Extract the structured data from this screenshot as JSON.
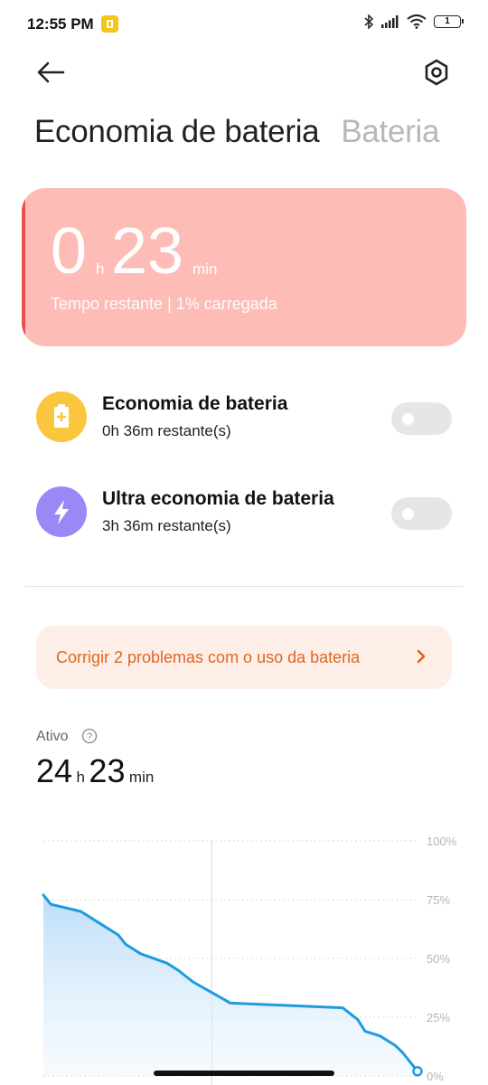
{
  "status_bar": {
    "time": "12:55 PM",
    "battery_level": "1",
    "notification_icon": "yellow-lock-app-icon"
  },
  "header": {
    "back_icon": "arrow-left-icon",
    "settings_icon": "gear-hexagon-icon"
  },
  "tabs": [
    {
      "label": "Economia de bateria",
      "active": true
    },
    {
      "label": "Bateria",
      "active": false
    }
  ],
  "summary_card": {
    "hours": "0",
    "hours_unit": "h",
    "minutes": "23",
    "minutes_unit": "min",
    "subtitle": "Tempo restante | 1% carregada",
    "bg_color": "#fdbcb5",
    "accent_color": "#e9514a"
  },
  "modes": [
    {
      "title": "Economia de bateria",
      "subtitle": "0h 36m restante(s)",
      "icon": "battery-plus-icon",
      "icon_color": "#fcc53e",
      "enabled": false
    },
    {
      "title": "Ultra economia de bateria",
      "subtitle": "3h 36m restante(s)",
      "icon": "lightning-bolt-icon",
      "icon_color": "#9b87f5",
      "enabled": false
    }
  ],
  "fix_banner": {
    "text": "Corrigir 2 problemas com o uso da bateria",
    "color": "#e0661d"
  },
  "active_usage": {
    "label": "Ativo",
    "hours": "24",
    "hours_unit": "h",
    "minutes": "23",
    "minutes_unit": "min"
  },
  "chart_data": {
    "type": "area",
    "y_ticks": [
      "100%",
      "75%",
      "50%",
      "25%",
      "0%"
    ],
    "ylim": [
      0,
      100
    ],
    "x_fraction": [
      0,
      0.02,
      0.1,
      0.18,
      0.2,
      0.22,
      0.26,
      0.33,
      0.36,
      0.4,
      0.5,
      0.8,
      0.84,
      0.86,
      0.9,
      0.94,
      0.96,
      1.0
    ],
    "values": [
      77,
      73,
      70,
      62,
      60,
      56,
      52,
      48,
      45,
      40,
      31,
      29,
      24,
      19,
      17,
      13,
      10,
      2
    ],
    "line_color": "#1e9be0",
    "grid": true,
    "vertical_marker_fraction": 0.45
  }
}
